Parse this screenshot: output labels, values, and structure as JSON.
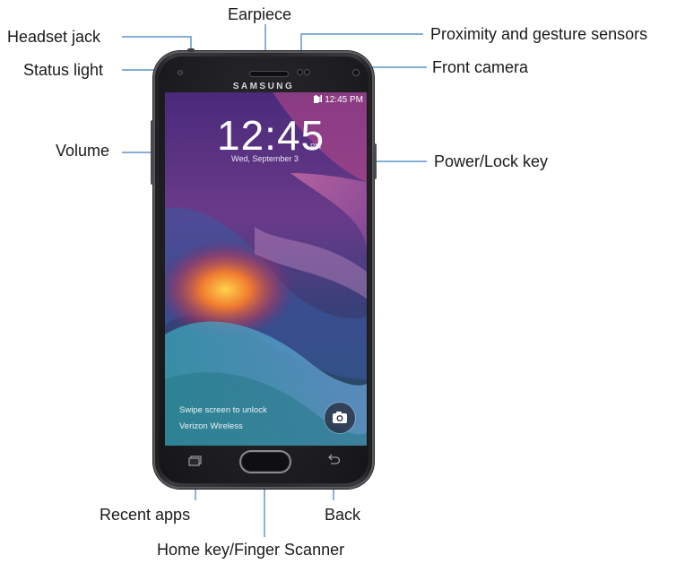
{
  "labels": {
    "headset_jack": "Headset jack",
    "status_light": "Status light",
    "earpiece": "Earpiece",
    "proximity_sensors": "Proximity and gesture sensors",
    "front_camera": "Front camera",
    "volume": "Volume",
    "power_lock_key": "Power/Lock key",
    "recent_apps": "Recent apps",
    "back": "Back",
    "home_key": "Home key/Finger Scanner"
  },
  "phone": {
    "brand": "SAMSUNG",
    "status_time": "12:45 PM",
    "clock": "12:45",
    "clock_ampm": "PM",
    "date": "Wed, September 3",
    "unlock_hint": "Swipe screen to unlock",
    "carrier": "Verizon Wireless"
  },
  "colors": {
    "leader_line": "#3a7fc1",
    "label_text": "#1a1a1a"
  }
}
